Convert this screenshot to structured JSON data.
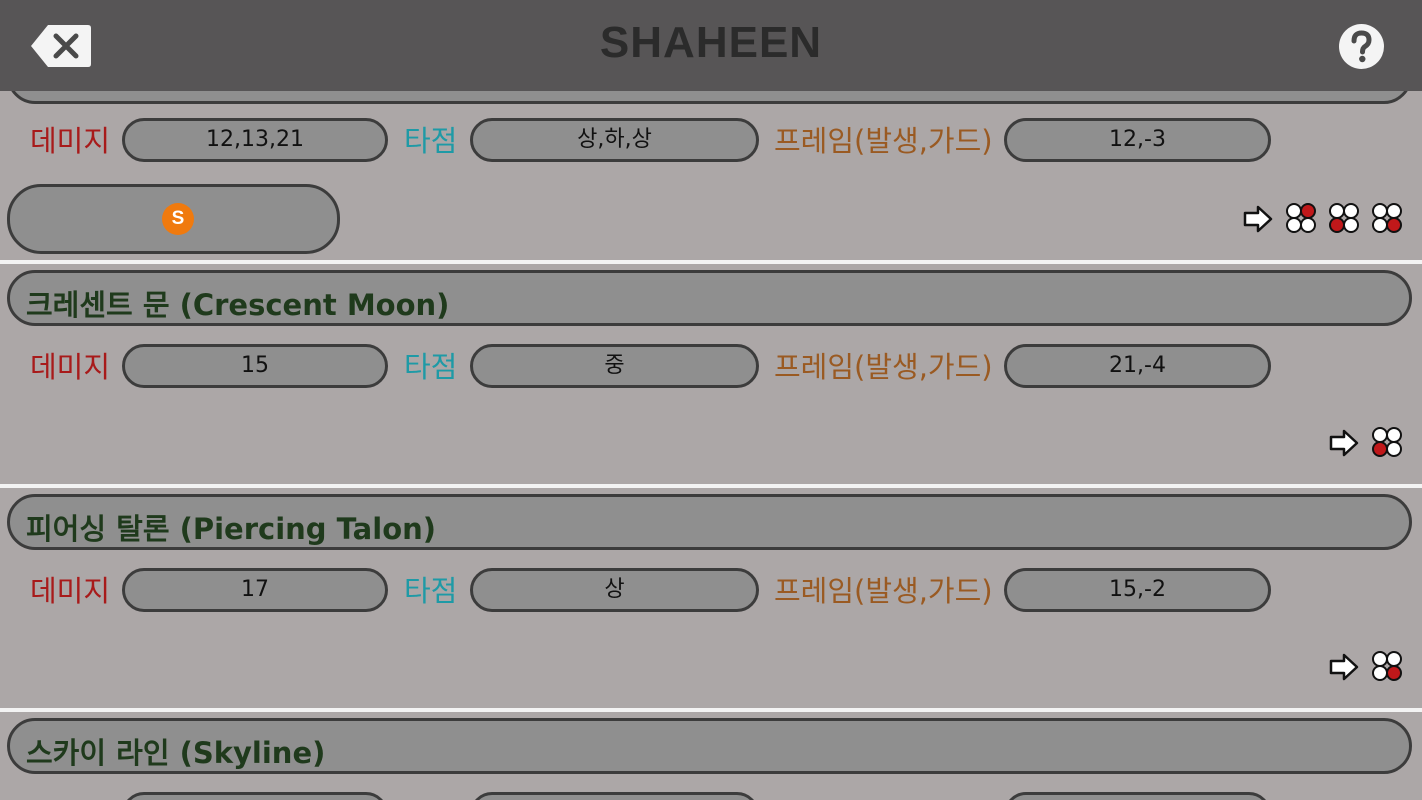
{
  "header": {
    "title": "SHAHEEN"
  },
  "labels": {
    "damage": "데미지",
    "hit": "타점",
    "frame": "프레임(발생,가드)"
  },
  "moves": [
    {
      "name": "",
      "damage": "12,13,21",
      "hit": "상,하,상",
      "frame": "12,-3",
      "command": [
        "forward-arrow",
        "button-1",
        "button-3",
        "button-4"
      ],
      "special_icon": "S"
    },
    {
      "name": "크레센트 문  (Crescent Moon)",
      "damage": "15",
      "hit": "중",
      "frame": "21,-4",
      "command": [
        "forward-arrow",
        "button-3"
      ]
    },
    {
      "name": "피어싱 탈론  (Piercing Talon)",
      "damage": "17",
      "hit": "상",
      "frame": "15,-2",
      "command": [
        "forward-arrow",
        "button-4"
      ]
    },
    {
      "name": "스카이 라인  (Skyline)"
    }
  ],
  "colors": {
    "header_bg": "#575556",
    "card_bg": "#aca7a7",
    "pill_bg": "#8f8f8f",
    "damage_label": "#a81a1a",
    "hit_label": "#1e9aa6",
    "frame_label": "#9a5a22",
    "button_pressed": "#c0181a"
  }
}
